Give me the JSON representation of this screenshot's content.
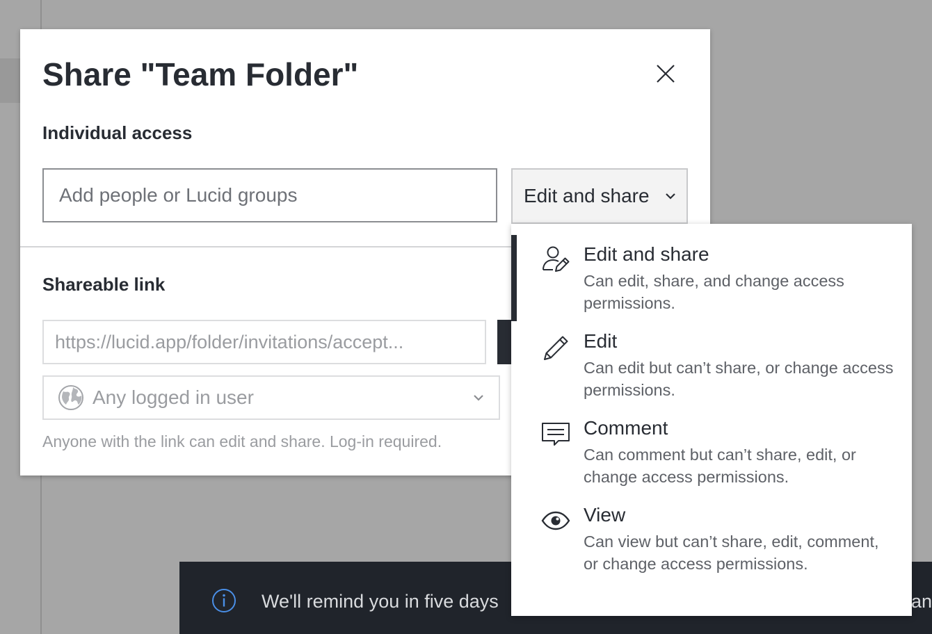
{
  "dialog": {
    "title": "Share \"Team Folder\"",
    "individual_access_label": "Individual access",
    "people_input_placeholder": "Add people or Lucid groups",
    "role_select_value": "Edit and share",
    "shareable_link_label": "Shareable link",
    "link_value": "https://lucid.app/folder/invitations/accept...",
    "link_access_value": "Any logged in user",
    "link_hint": "Anyone with the link can edit and share. Log-in required."
  },
  "role_menu": {
    "items": [
      {
        "title": "Edit and share",
        "description": "Can edit, share, and change access permissions.",
        "icon": "user-edit-icon",
        "selected": true
      },
      {
        "title": "Edit",
        "description": "Can edit but can’t share, or change access permissions.",
        "icon": "pencil-icon",
        "selected": false
      },
      {
        "title": "Comment",
        "description": "Can comment but can’t share, edit, or change access permissions.",
        "icon": "comment-icon",
        "selected": false
      },
      {
        "title": "View",
        "description": "Can view but can’t share, edit, comment, or change access permissions.",
        "icon": "eye-icon",
        "selected": false
      }
    ]
  },
  "toast": {
    "message": "We'll remind you in five days",
    "message_tail": "an",
    "icon": "info-icon"
  },
  "colors": {
    "text_primary": "#282c33",
    "text_muted": "#9a9ca0",
    "toast_bg": "#20242b",
    "info_accent": "#4a8fe7",
    "overlay": "#a6a6a6"
  }
}
